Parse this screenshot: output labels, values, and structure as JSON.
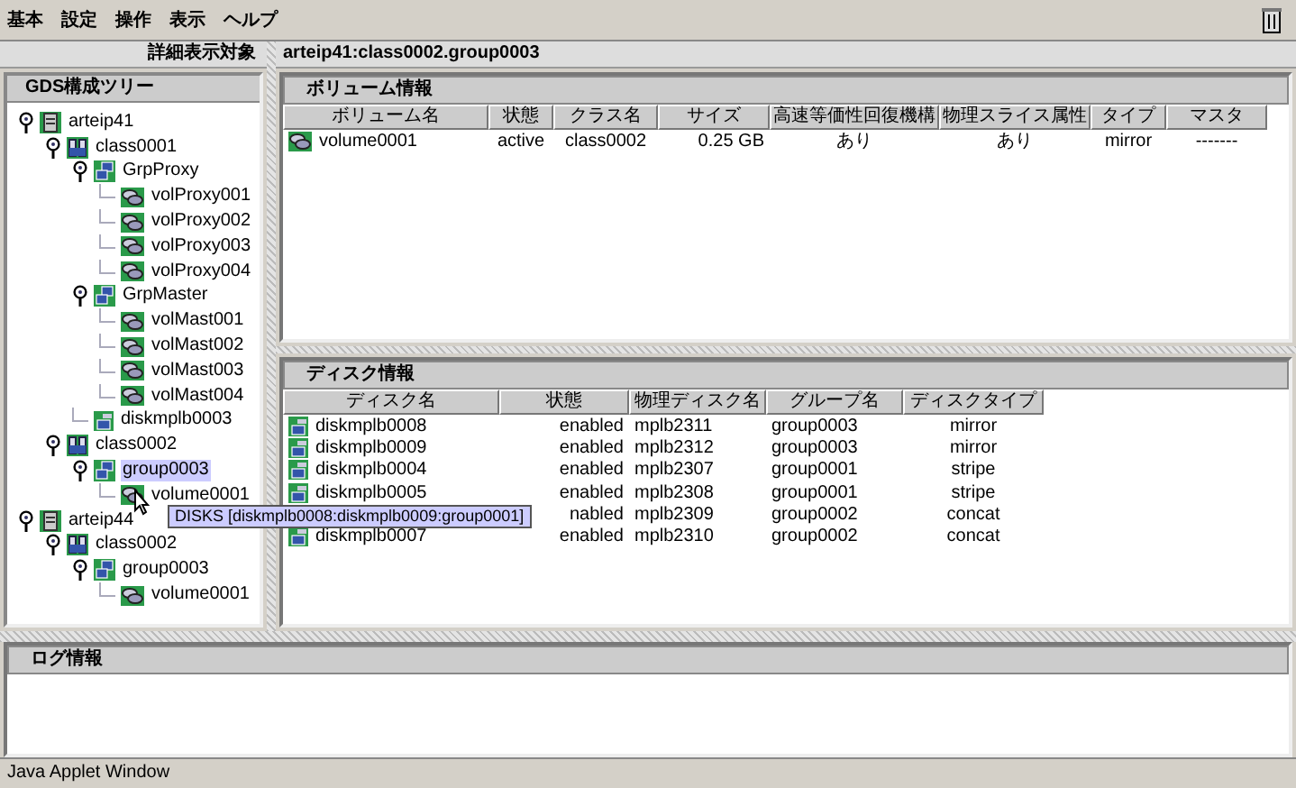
{
  "menu": [
    "基本",
    "設定",
    "操作",
    "表示",
    "ヘルプ"
  ],
  "left": {
    "header": "詳細表示対象",
    "tree_title": "GDS構成ツリー",
    "tree": [
      {
        "kind": "server",
        "label": "arteip41",
        "expanded": true,
        "selected": false,
        "children": [
          {
            "kind": "class",
            "label": "class0001",
            "expanded": true,
            "selected": false,
            "children": [
              {
                "kind": "group",
                "label": "GrpProxy",
                "expanded": true,
                "selected": false,
                "children": [
                  {
                    "kind": "volume",
                    "label": "volProxy001",
                    "selected": false
                  },
                  {
                    "kind": "volume",
                    "label": "volProxy002",
                    "selected": false
                  },
                  {
                    "kind": "volume",
                    "label": "volProxy003",
                    "selected": false
                  },
                  {
                    "kind": "volume",
                    "label": "volProxy004",
                    "selected": false
                  }
                ]
              },
              {
                "kind": "group",
                "label": "GrpMaster",
                "expanded": true,
                "selected": false,
                "children": [
                  {
                    "kind": "volume",
                    "label": "volMast001",
                    "selected": false
                  },
                  {
                    "kind": "volume",
                    "label": "volMast002",
                    "selected": false
                  },
                  {
                    "kind": "volume",
                    "label": "volMast003",
                    "selected": false
                  },
                  {
                    "kind": "volume",
                    "label": "volMast004",
                    "selected": false
                  }
                ]
              },
              {
                "kind": "disk",
                "label": "diskmplb0003",
                "selected": false
              }
            ]
          },
          {
            "kind": "class",
            "label": "class0002",
            "expanded": true,
            "selected": false,
            "children": [
              {
                "kind": "group",
                "label": "group0003",
                "expanded": true,
                "selected": true,
                "children": [
                  {
                    "kind": "volume",
                    "label": "volume0001",
                    "selected": false
                  }
                ]
              }
            ]
          }
        ]
      },
      {
        "kind": "server",
        "label": "arteip44",
        "expanded": true,
        "selected": false,
        "children": [
          {
            "kind": "class",
            "label": "class0002",
            "expanded": true,
            "selected": false,
            "children": [
              {
                "kind": "group",
                "label": "group0003",
                "expanded": true,
                "selected": false,
                "children": [
                  {
                    "kind": "volume",
                    "label": "volume0001",
                    "selected": false
                  }
                ]
              }
            ]
          }
        ]
      }
    ]
  },
  "target": "arteip41:class0002.group0003",
  "volume_panel": {
    "title": "ボリューム情報",
    "columns": [
      "ボリューム名",
      "状態",
      "クラス名",
      "サイズ",
      "高速等価性回復機構",
      "物理スライス属性",
      "タイプ",
      "マスタ"
    ],
    "rows": [
      [
        "volume0001",
        "active",
        "class0002",
        "0.25 GB",
        "あり",
        "あり",
        "mirror",
        "-------"
      ]
    ]
  },
  "disk_panel": {
    "title": "ディスク情報",
    "columns": [
      "ディスク名",
      "状態",
      "物理ディスク名",
      "グループ名",
      "ディスクタイプ"
    ],
    "rows": [
      [
        "diskmplb0008",
        "enabled",
        "mplb2311",
        "group0003",
        "mirror"
      ],
      [
        "diskmplb0009",
        "enabled",
        "mplb2312",
        "group0003",
        "mirror"
      ],
      [
        "diskmplb0004",
        "enabled",
        "mplb2307",
        "group0001",
        "stripe"
      ],
      [
        "diskmplb0005",
        "enabled",
        "mplb2308",
        "group0001",
        "stripe"
      ],
      [
        null,
        "nabled",
        "mplb2309",
        "group0002",
        "concat"
      ],
      [
        "diskmplb0007",
        "enabled",
        "mplb2310",
        "group0002",
        "concat"
      ]
    ]
  },
  "tooltip": "DISKS [diskmplb0008:diskmplb0009:group0001]",
  "log_panel": {
    "title": "ログ情報"
  },
  "status_bar": "Java Applet Window"
}
